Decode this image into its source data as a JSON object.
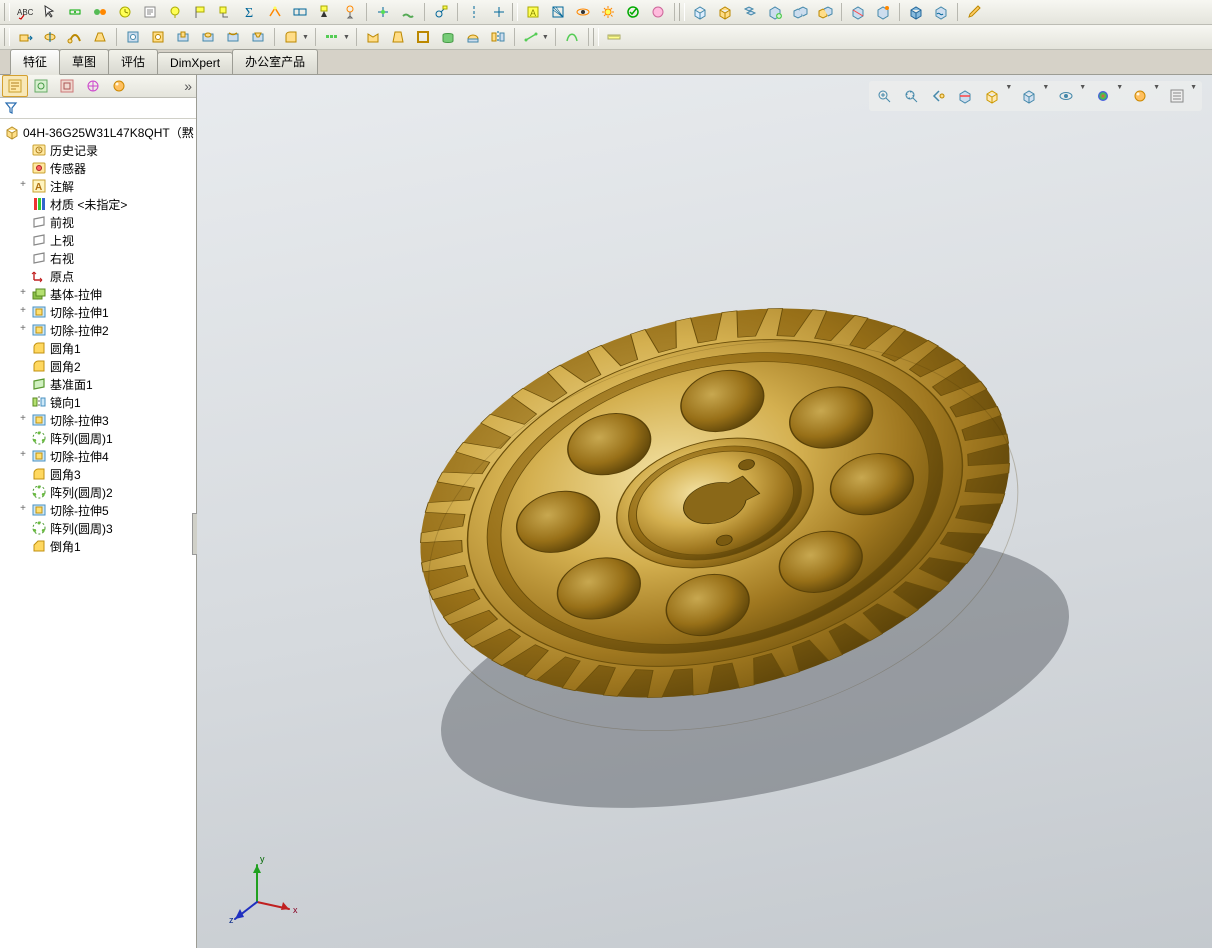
{
  "tabs": {
    "features": "特征",
    "sketch": "草图",
    "evaluate": "评估",
    "dimxpert": "DimXpert",
    "office": "办公室产品"
  },
  "tree": {
    "root": "04H-36G25W31L47K8QHT（黙",
    "items": [
      {
        "label": "历史记录",
        "icon": "history",
        "exp": ""
      },
      {
        "label": "传感器",
        "icon": "sensor",
        "exp": ""
      },
      {
        "label": "注解",
        "icon": "annot",
        "exp": "+"
      },
      {
        "label": "材质 <未指定>",
        "icon": "material",
        "exp": ""
      },
      {
        "label": "前视",
        "icon": "plane",
        "exp": ""
      },
      {
        "label": "上视",
        "icon": "plane",
        "exp": ""
      },
      {
        "label": "右视",
        "icon": "plane",
        "exp": ""
      },
      {
        "label": "原点",
        "icon": "origin",
        "exp": ""
      },
      {
        "label": "基体-拉伸",
        "icon": "boss",
        "exp": "+"
      },
      {
        "label": "切除-拉伸1",
        "icon": "cut",
        "exp": "+"
      },
      {
        "label": "切除-拉伸2",
        "icon": "cut",
        "exp": "+"
      },
      {
        "label": "圆角1",
        "icon": "fillet",
        "exp": ""
      },
      {
        "label": "圆角2",
        "icon": "fillet",
        "exp": ""
      },
      {
        "label": "基准面1",
        "icon": "refplane",
        "exp": ""
      },
      {
        "label": "镜向1",
        "icon": "mirror",
        "exp": ""
      },
      {
        "label": "切除-拉伸3",
        "icon": "cut",
        "exp": "+"
      },
      {
        "label": "阵列(圆周)1",
        "icon": "pattern",
        "exp": ""
      },
      {
        "label": "切除-拉伸4",
        "icon": "cut",
        "exp": "+"
      },
      {
        "label": "圆角3",
        "icon": "fillet",
        "exp": ""
      },
      {
        "label": "阵列(圆周)2",
        "icon": "pattern",
        "exp": ""
      },
      {
        "label": "切除-拉伸5",
        "icon": "cut",
        "exp": "+"
      },
      {
        "label": "阵列(圆周)3",
        "icon": "pattern",
        "exp": ""
      },
      {
        "label": "倒角1",
        "icon": "chamfer",
        "exp": ""
      }
    ]
  },
  "triad": {
    "x": "x",
    "y": "y",
    "z": "z"
  }
}
